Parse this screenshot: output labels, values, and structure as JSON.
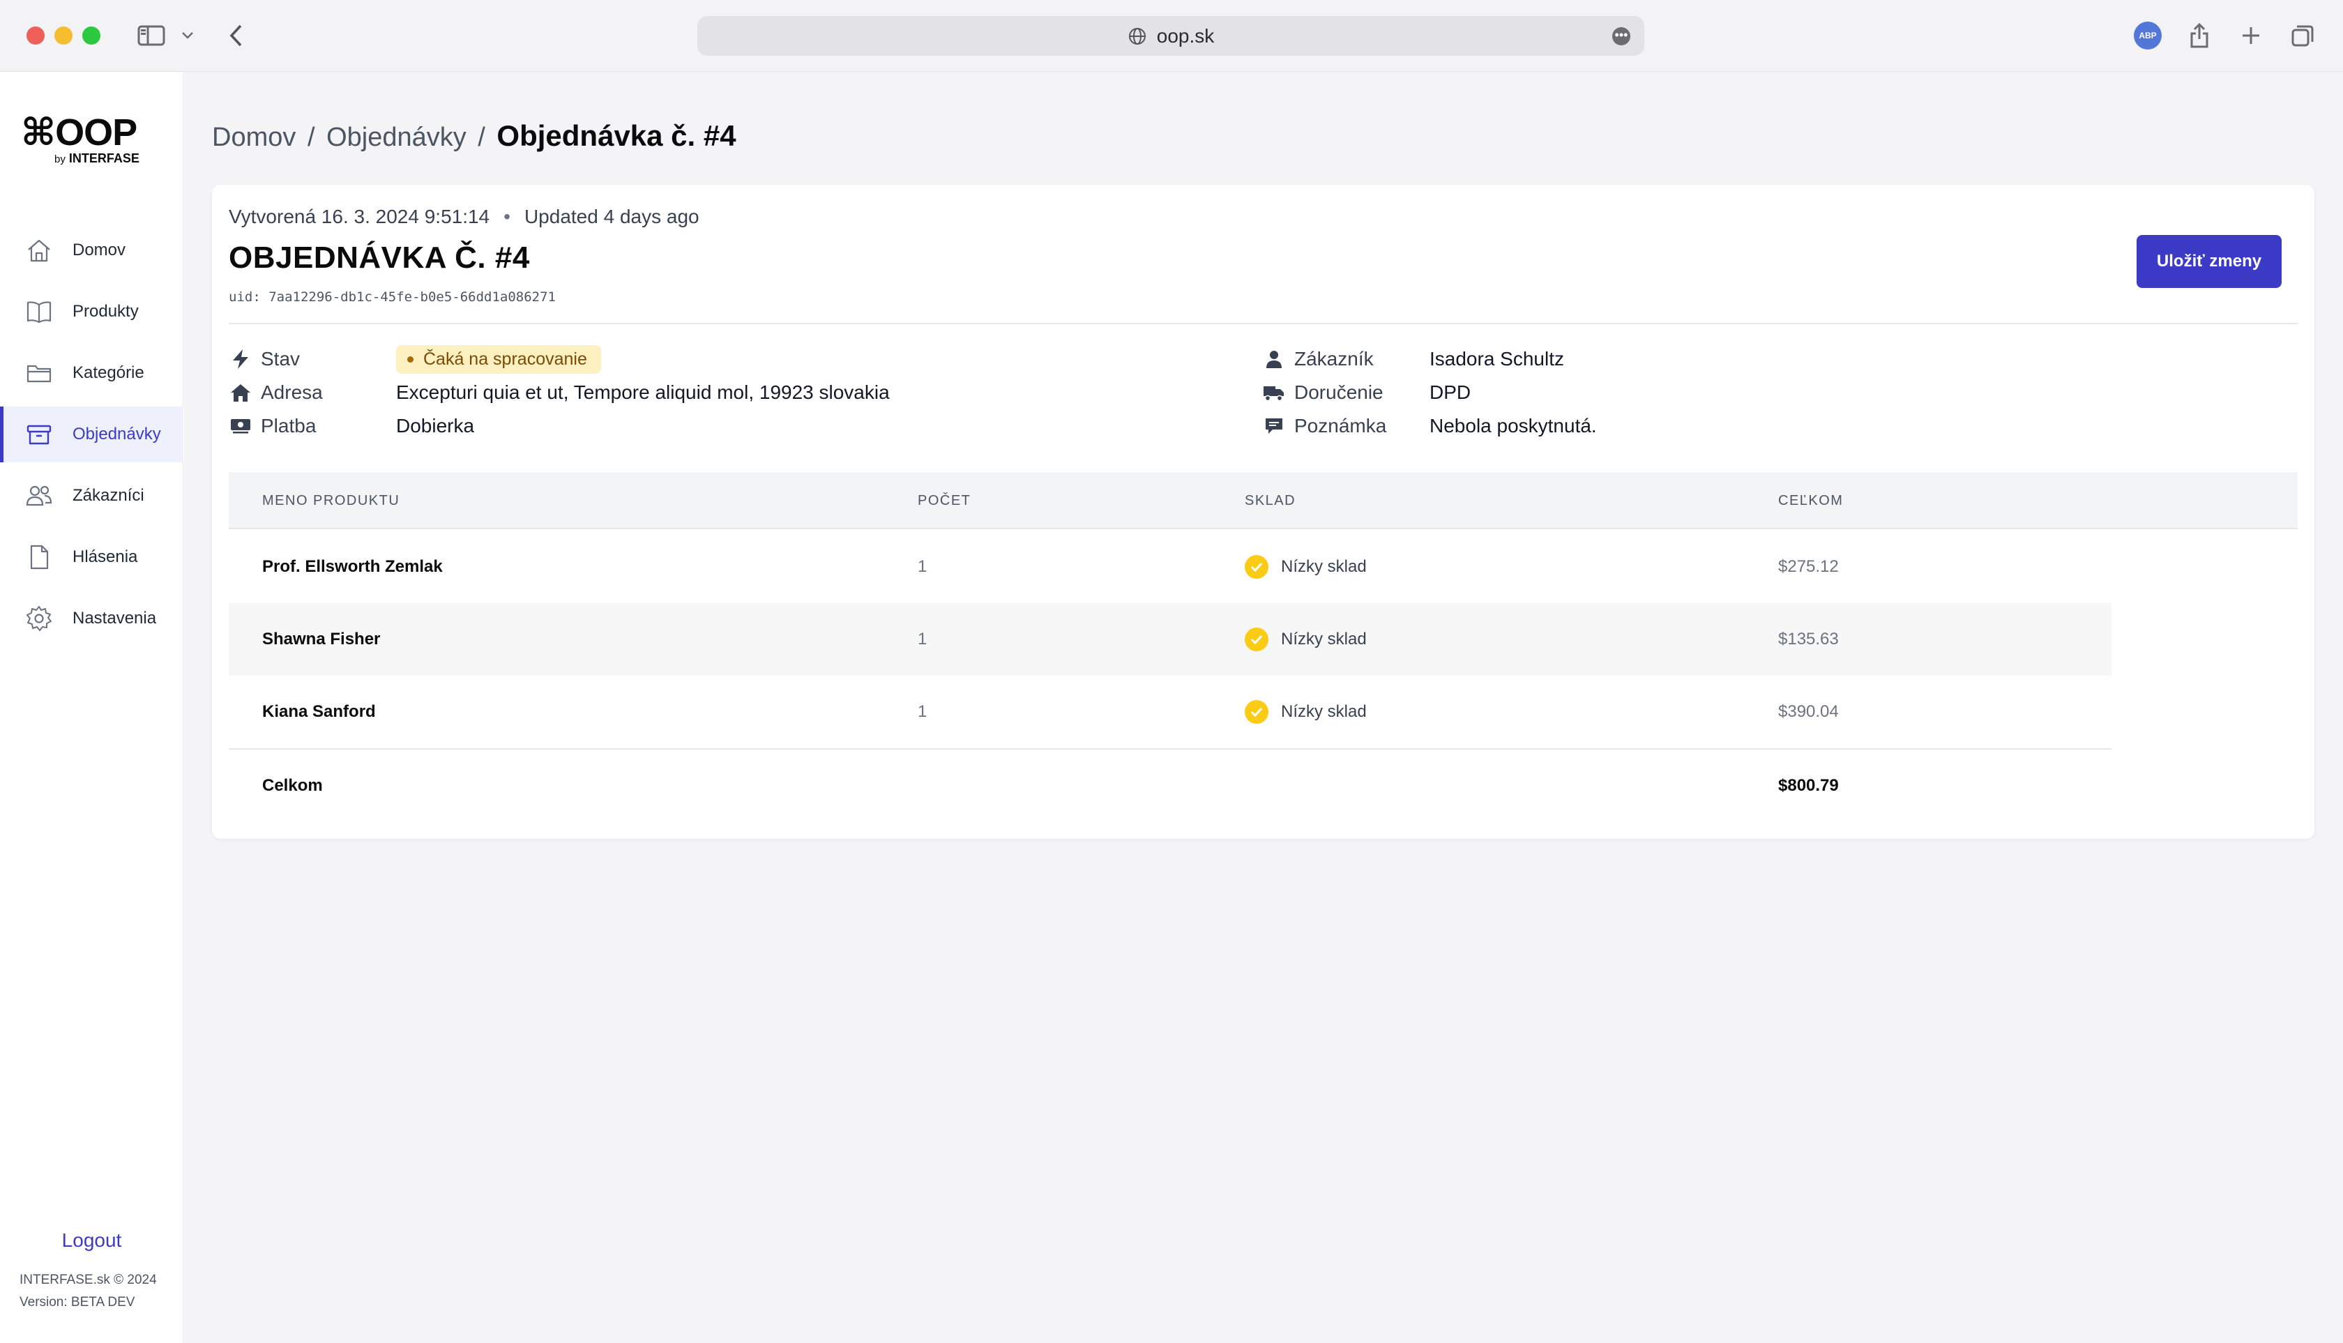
{
  "browser": {
    "url": "oop.sk",
    "colors": {
      "close": "#ee5f57",
      "minimize": "#f5bd2f",
      "zoom": "#2bc840"
    }
  },
  "sidebar": {
    "logo": {
      "symbol": "⌘",
      "name": "OOP",
      "by": "by",
      "brand": "INTERFASE"
    },
    "items": [
      {
        "label": "Domov",
        "icon": "home-icon"
      },
      {
        "label": "Produkty",
        "icon": "book-icon"
      },
      {
        "label": "Kategórie",
        "icon": "folder-icon"
      },
      {
        "label": "Objednávky",
        "icon": "archive-box-icon"
      },
      {
        "label": "Zákazníci",
        "icon": "users-icon"
      },
      {
        "label": "Hlásenia",
        "icon": "document-icon"
      },
      {
        "label": "Nastavenia",
        "icon": "gear-icon"
      }
    ],
    "active_item": "Objednávky",
    "logout": "Logout",
    "footer_copyright": "INTERFASE.sk © 2024",
    "footer_version": "Version: BETA DEV",
    "accent": "#3b3bc8"
  },
  "breadcrumb": {
    "home": "Domov",
    "sep": "/",
    "section": "Objednávky",
    "current": "Objednávka č. #4"
  },
  "order": {
    "created": "Vytvorená 16. 3. 2024 9:51:14",
    "updated": "Updated 4 days ago",
    "title": "OBJEDNÁVKA Č. #4",
    "uid": "uid: 7aa12296-db1c-45fe-b0e5-66dd1a086271",
    "save_label": "Uložiť zmeny",
    "info": {
      "status_label": "Stav",
      "status_value": "Čaká na spracovanie",
      "address_label": "Adresa",
      "address_value": "Excepturi quia et ut, Tempore aliquid mol, 19923 slovakia",
      "payment_label": "Platba",
      "payment_value": "Dobierka",
      "customer_label": "Zákazník",
      "customer_value": "Isadora Schultz",
      "delivery_label": "Doručenie",
      "delivery_value": "DPD",
      "note_label": "Poznámka",
      "note_value": "Nebola poskytnutá."
    }
  },
  "table": {
    "columns": [
      "MENO PRODUKTU",
      "POČET",
      "SKLAD",
      "CEĽKOM"
    ],
    "rows": [
      {
        "name": "Prof. Ellsworth Zemlak",
        "qty": "1",
        "stock": "Nízky sklad",
        "total": "$275.12"
      },
      {
        "name": "Shawna Fisher",
        "qty": "1",
        "stock": "Nízky sklad",
        "total": "$135.63"
      },
      {
        "name": "Kiana Sanford",
        "qty": "1",
        "stock": "Nízky sklad",
        "total": "$390.04"
      }
    ],
    "total_label": "Celkom",
    "total_value": "$800.79"
  }
}
